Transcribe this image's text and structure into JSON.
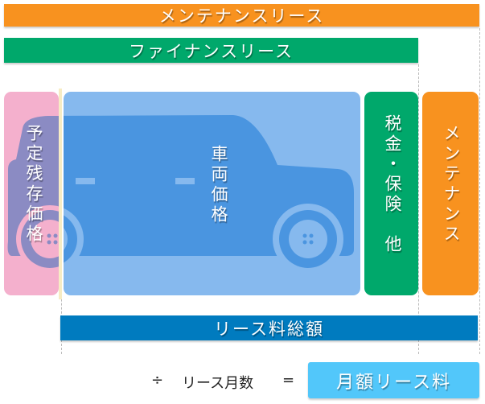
{
  "bars": {
    "maintenance_lease": "メンテナンスリース",
    "finance_lease": "ファイナンスリース",
    "total_lease_fee": "リース料総額"
  },
  "boxes": {
    "residual_value": "予定残存価格",
    "vehicle_price": "車両価格",
    "tax_insurance": "税金・保険　他",
    "maintenance": "メンテナンス"
  },
  "formula": {
    "divide": "÷",
    "lease_months": "リース月数",
    "equals": "=",
    "monthly_fee": "月額リース料"
  },
  "colors": {
    "orange": "#f8921f",
    "green": "#00a86b",
    "pink": "#f4b0cd",
    "light_blue": "#86b9ee",
    "car_blue": "#4a95e0",
    "dark_blue": "#007bbf",
    "sky_blue": "#52c7fa"
  },
  "icons": {
    "car": "car-silhouette-icon"
  }
}
